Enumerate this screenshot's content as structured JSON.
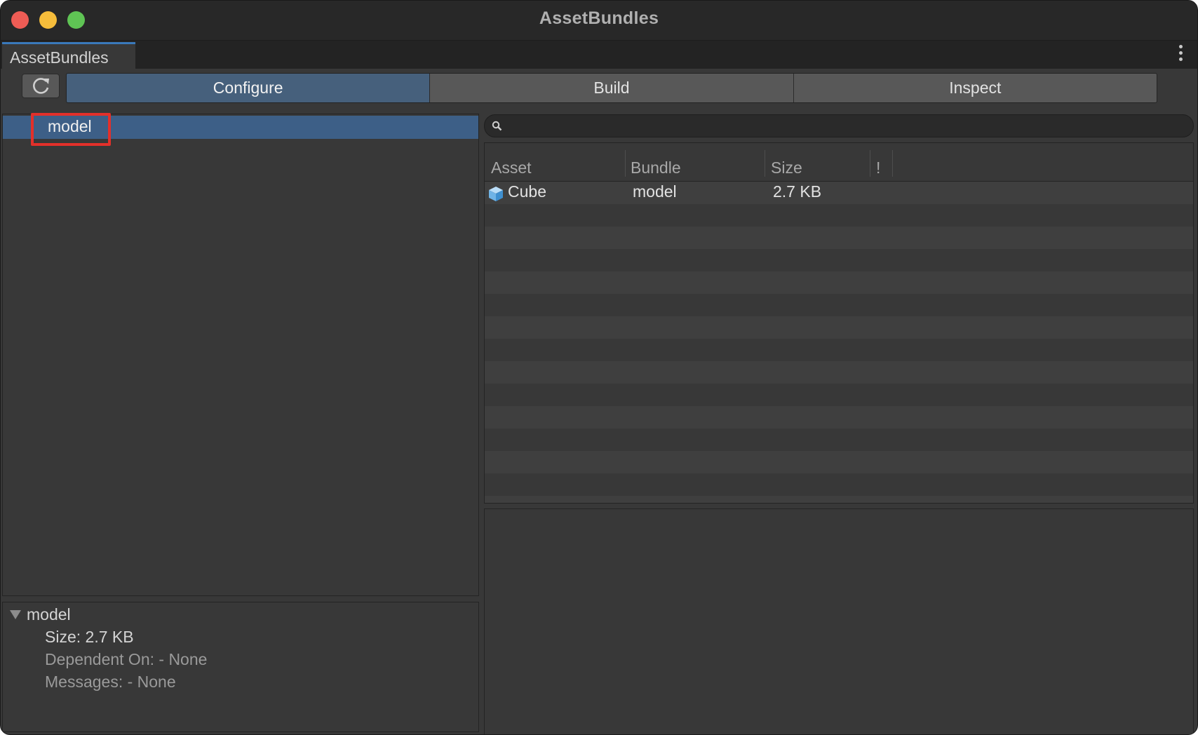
{
  "window": {
    "title": "AssetBundles"
  },
  "tabstrip": {
    "tab_label": "AssetBundles"
  },
  "toolbar": {
    "tabs": [
      {
        "label": "Configure",
        "active": true
      },
      {
        "label": "Build",
        "active": false
      },
      {
        "label": "Inspect",
        "active": false
      }
    ]
  },
  "bundle_list": {
    "items": [
      {
        "label": "model",
        "selected": true
      }
    ]
  },
  "details": {
    "name": "model",
    "size": "Size: 2.7 KB",
    "dependent_on": "Dependent On: - None",
    "messages": "Messages: - None"
  },
  "search": {
    "value": "",
    "placeholder": ""
  },
  "asset_table": {
    "columns": [
      "Asset",
      "Bundle",
      "Size",
      "!"
    ],
    "rows": [
      {
        "asset": "Cube",
        "bundle": "model",
        "size": "2.7 KB",
        "icon": "cube-icon"
      }
    ]
  },
  "colors": {
    "accent": "#3a79bb",
    "selection": "#3d5f87",
    "active_tab": "#46607c",
    "annotation": "#e3302a"
  }
}
